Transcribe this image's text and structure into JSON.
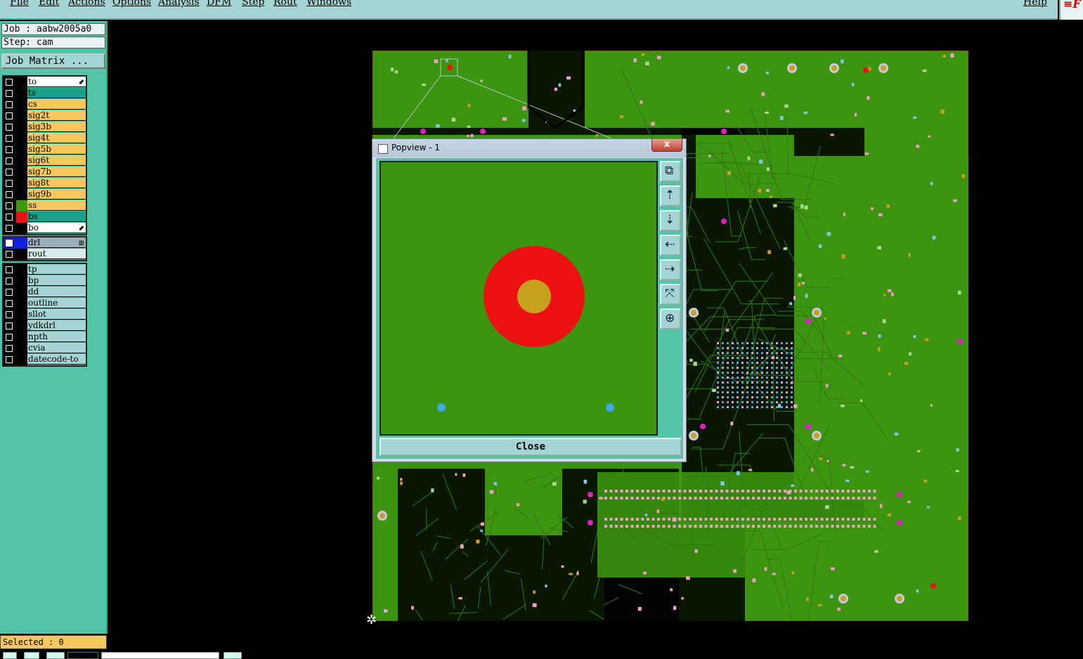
{
  "menu": [
    "File",
    "Edit",
    "Actions",
    "Options",
    "Analysis",
    "DFM",
    "Step",
    "Rout",
    "Windows"
  ],
  "help_label": "Help",
  "job_label": "Job : aabw2005a0",
  "step_label": "Step: cam",
  "job_matrix_label": "Job Matrix ...",
  "board_layers": [
    {
      "name": "to",
      "color": "#ffffff",
      "swatch": "#000000",
      "arrow": true
    },
    {
      "name": "ts",
      "color": "#1aa088",
      "swatch": "#000000"
    },
    {
      "name": "cs",
      "color": "#f8c860",
      "swatch": "#000000"
    },
    {
      "name": "sig2t",
      "color": "#f8c860",
      "swatch": "#000000"
    },
    {
      "name": "sig3b",
      "color": "#f8c860",
      "swatch": "#000000"
    },
    {
      "name": "sig4t",
      "color": "#f8c860",
      "swatch": "#000000"
    },
    {
      "name": "sig5b",
      "color": "#f8c860",
      "swatch": "#000000"
    },
    {
      "name": "sig6t",
      "color": "#f8c860",
      "swatch": "#000000"
    },
    {
      "name": "sig7b",
      "color": "#f8c860",
      "swatch": "#000000"
    },
    {
      "name": "sig8t",
      "color": "#f8c860",
      "swatch": "#000000"
    },
    {
      "name": "sig9b",
      "color": "#f8c860",
      "swatch": "#000000"
    },
    {
      "name": "ss",
      "color": "#f8c860",
      "swatch": "#3a9a10"
    },
    {
      "name": "bs",
      "color": "#1aa088",
      "swatch": "#ee1111"
    },
    {
      "name": "bo",
      "color": "#ffffff",
      "swatch": "#000000",
      "arrow": true
    }
  ],
  "drill_layers": [
    {
      "name": "drl",
      "color": "#9ab0b8",
      "swatch": "#1020e0",
      "arrow": true
    },
    {
      "name": "rout",
      "color": "#dce8ec",
      "swatch": "#000000"
    }
  ],
  "misc_layers": [
    "tp",
    "bp",
    "dd",
    "outline",
    "sllot",
    "ydkdrl",
    "npth",
    "cvia",
    "datecode-to"
  ],
  "selected_label": "Selected : 0",
  "popview": {
    "title": "Popview - 1",
    "close_x": "x",
    "close_label": "Close",
    "tool_icons": [
      "zoom-window-icon",
      "pan-up-icon",
      "pan-down-icon",
      "pan-left-icon",
      "pan-right-icon",
      "zoom-fit-icon",
      "zoom-home-icon"
    ]
  },
  "colors": {
    "board_green": "#3c9410",
    "trace_dark": "#1b4a06",
    "pad_orange": "#c8a020",
    "pad_red": "#ee1111",
    "via_blue": "#40a8e8",
    "magenta": "#e020c0",
    "pink": "#f0a0c0"
  }
}
